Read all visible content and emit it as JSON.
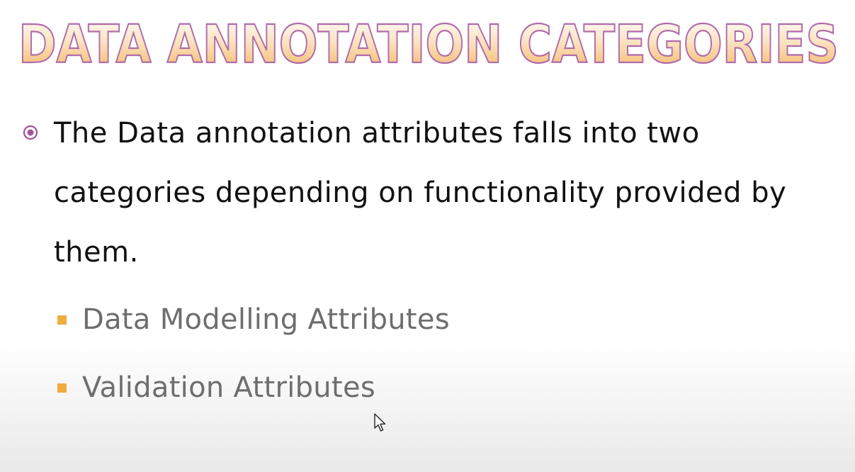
{
  "slide": {
    "title": "DATA ANNOTATION CATEGORIES",
    "main_bullet": "The Data annotation attributes falls into two categories depending on functionality provided by them.",
    "sub_bullets": [
      "Data Modelling Attributes",
      "Validation Attributes"
    ],
    "colors": {
      "title_fill_top": "#ffffff",
      "title_fill_bottom": "#f3b45c",
      "title_outline": "#b06cab",
      "main_bullet_marker": "#a3539b",
      "sub_bullet_marker": "#f0ac3c",
      "main_text": "#111111",
      "sub_text": "#6e6e6e"
    },
    "icons": {
      "main_bullet": "circle-dot-icon",
      "sub_bullet": "square-icon",
      "pointer": "mouse-pointer-icon"
    }
  }
}
